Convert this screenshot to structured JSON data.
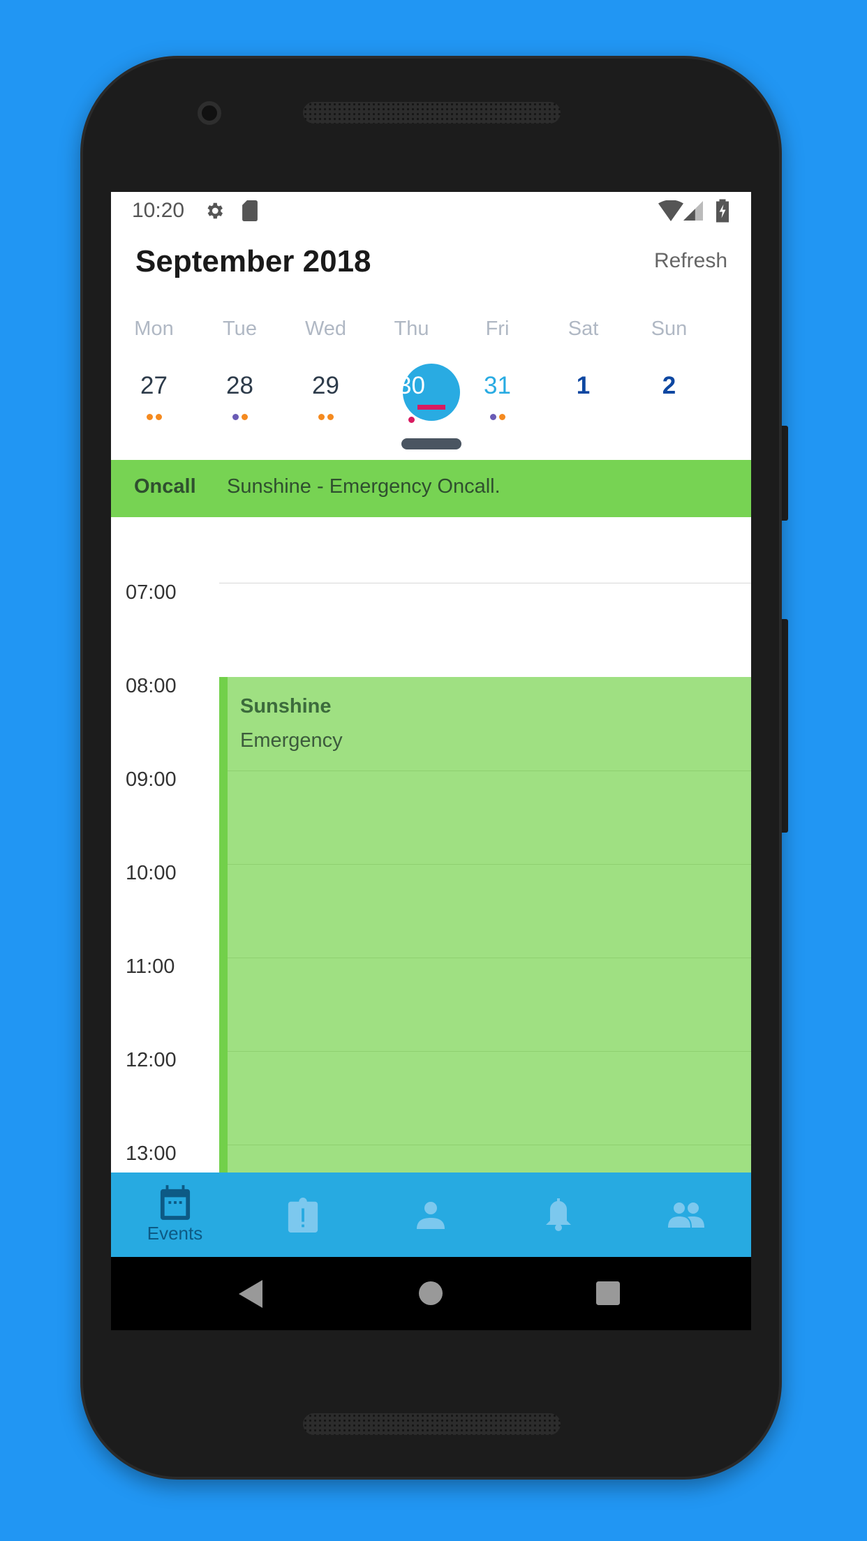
{
  "status_bar": {
    "time": "10:20",
    "icons": [
      "gear-icon",
      "sd-card-icon",
      "wifi-icon",
      "signal-icon",
      "battery-charging-icon"
    ]
  },
  "header": {
    "title": "September 2018",
    "refresh_label": "Refresh"
  },
  "week": {
    "days": [
      {
        "weekday": "Mon",
        "date": "27",
        "dots": [
          "#f58a1f",
          "#f58a1f"
        ],
        "color": "#2d3b4a"
      },
      {
        "weekday": "Tue",
        "date": "28",
        "dots": [
          "#6a5bb5",
          "#f58a1f"
        ],
        "color": "#2d3b4a"
      },
      {
        "weekday": "Wed",
        "date": "29",
        "dots": [
          "#f58a1f",
          "#f58a1f"
        ],
        "color": "#2d3b4a"
      },
      {
        "weekday": "Thu",
        "date": "30",
        "dots": [
          "#d81b60"
        ],
        "color": "#ffffff",
        "selected": true
      },
      {
        "weekday": "Fri",
        "date": "31",
        "dots": [
          "#6a5bb5",
          "#f58a1f"
        ],
        "color": "#29abe2"
      },
      {
        "weekday": "Sat",
        "date": "1",
        "dots": [],
        "color": "#0d47a1"
      },
      {
        "weekday": "Sun",
        "date": "2",
        "dots": [],
        "color": "#0d47a1"
      }
    ]
  },
  "oncall": {
    "label": "Oncall",
    "text": "Sunshine - Emergency Oncall."
  },
  "timeline": {
    "hours": [
      "07:00",
      "08:00",
      "09:00",
      "10:00",
      "11:00",
      "12:00",
      "13:00"
    ]
  },
  "event": {
    "title": "Sunshine",
    "subtitle": "Emergency",
    "color": "#9fe082"
  },
  "bottom_nav": {
    "items": [
      {
        "label": "Events",
        "icon": "calendar-icon",
        "active": true
      },
      {
        "icon": "alert-clipboard-icon"
      },
      {
        "icon": "person-icon"
      },
      {
        "icon": "bell-icon"
      },
      {
        "icon": "group-icon"
      }
    ]
  },
  "colors": {
    "accent": "#27aae1",
    "oncall": "#77d353",
    "background": "#2196F3"
  }
}
